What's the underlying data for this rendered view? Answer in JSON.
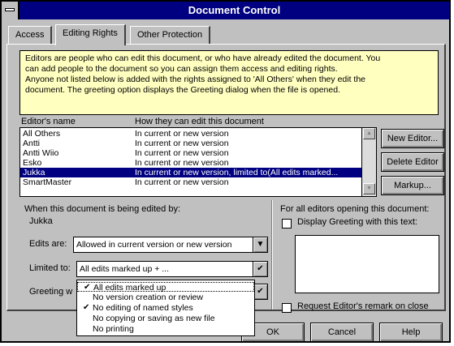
{
  "window": {
    "title": "Document Control"
  },
  "tabs": [
    {
      "label": "Access"
    },
    {
      "label": "Editing Rights"
    },
    {
      "label": "Other Protection"
    }
  ],
  "info_text": [
    "Editors are people who can edit this document, or who have already edited the document. You",
    "can add people to the document so you can assign them access and editing rights.",
    "Anyone not listed below is added with the rights assigned to 'All Others' when they edit the",
    "document. The greeting option displays the Greeting dialog when the file is opened."
  ],
  "editors_list": {
    "col_name": "Editor's name",
    "col_how": "How they can edit this document",
    "rows": [
      {
        "name": "All Others",
        "how": "In current or new version"
      },
      {
        "name": "Antti",
        "how": "In current or new version"
      },
      {
        "name": "Antti Wiio",
        "how": "In current or new version"
      },
      {
        "name": "Esko",
        "how": "In current or new version"
      },
      {
        "name": "Jukka",
        "how": "In current or new version, limited to(All edits marked..."
      },
      {
        "name": "SmartMaster",
        "how": "In current or new version"
      }
    ],
    "selected_index": 4
  },
  "side_buttons": {
    "new_editor": "New Editor...",
    "delete_editor": "Delete Editor",
    "markup": "Markup..."
  },
  "editing": {
    "being_edited_label": "When this document is being edited by:",
    "editor_name": "Jukka",
    "edits_are_label": "Edits are:",
    "edits_are_value": "Allowed in current version or new version",
    "limited_to_label": "Limited to:",
    "limited_to_value": "All edits marked up + ...",
    "greeting_label": "Greeting w"
  },
  "limited_options": [
    {
      "label": "All edits marked up",
      "checked": true
    },
    {
      "label": "No version creation or review",
      "checked": false
    },
    {
      "label": "No editing of named styles",
      "checked": true
    },
    {
      "label": "No copying or saving as new file",
      "checked": false
    },
    {
      "label": "No printing",
      "checked": false
    }
  ],
  "greeting_panel": {
    "heading": "For all editors opening this document:",
    "display_greeting_label": "Display Greeting with this text:",
    "display_greeting_checked": false,
    "request_remark_label": "Request Editor's remark on close",
    "request_remark_checked": false
  },
  "bottom_buttons": {
    "ok": "OK",
    "cancel": "Cancel",
    "help": "Help"
  },
  "glyphs": {
    "check": "✔",
    "dropdown_arrow": "▼",
    "scroll_up": "▲",
    "scroll_down": "▼"
  },
  "colors": {
    "titlebar": "#000080",
    "selection": "#000080",
    "info_background": "#ffffc0",
    "dialog_face": "#c0c0c0"
  }
}
